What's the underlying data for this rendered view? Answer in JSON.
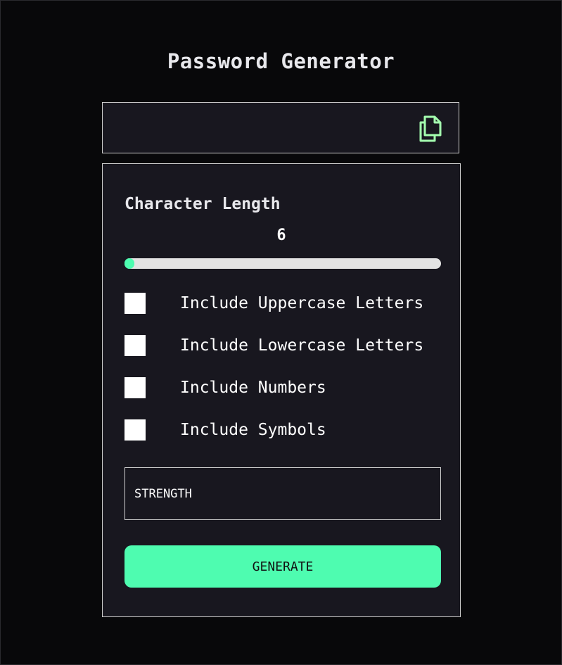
{
  "app": {
    "title": "Password Generator"
  },
  "output": {
    "password": "",
    "copy_icon": "copy-icon"
  },
  "length": {
    "label": "Character Length",
    "value": "6",
    "slider_fraction": 0
  },
  "options": [
    {
      "label": "Include Uppercase Letters",
      "checked": false
    },
    {
      "label": "Include Lowercase Letters",
      "checked": false
    },
    {
      "label": "Include Numbers",
      "checked": false
    },
    {
      "label": "Include Symbols",
      "checked": false
    }
  ],
  "strength": {
    "label": "STRENGTH"
  },
  "generate": {
    "label": "GENERATE"
  },
  "colors": {
    "background": "#08080a",
    "panel": "#18171f",
    "accent": "#4efcb0",
    "copy_icon": "#a4ffaf",
    "track": "#e3e3e3"
  }
}
